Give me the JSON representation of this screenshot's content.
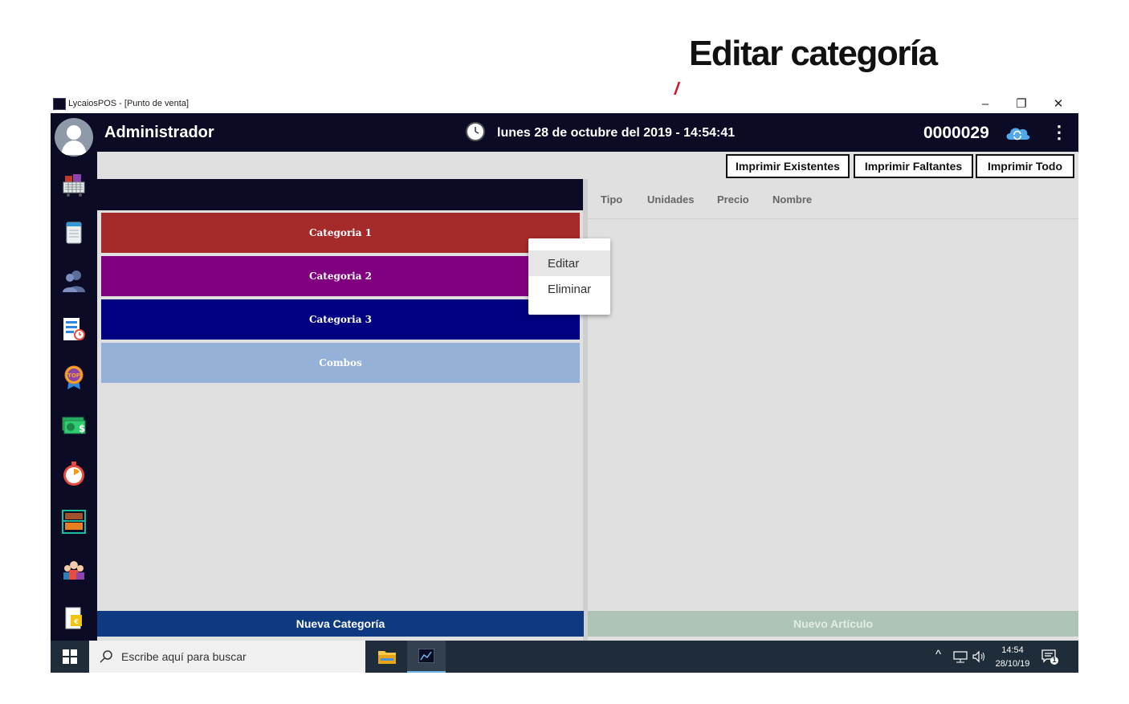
{
  "annotation": {
    "title": "Editar categoría"
  },
  "window": {
    "title": "LycaiosPOS - [Punto de venta]",
    "controls": {
      "minimize": "–",
      "restore": "❐",
      "close": "✕"
    }
  },
  "header": {
    "user": "Administrador",
    "datetime": "lunes 28 de octubre del 2019 - 14:54:41",
    "ticket_number": "0000029",
    "menu_icon": "⋮"
  },
  "sidebar": {
    "icons": [
      "cart-icon",
      "notebook-icon",
      "users-icon",
      "schedule-icon",
      "top-badge-icon",
      "money-icon",
      "timer-icon",
      "shelf-icon",
      "team-icon",
      "document-icon"
    ]
  },
  "toolbar": {
    "buttons": [
      "Imprimir Existentes",
      "Imprimir Faltantes",
      "Imprimir Todo"
    ]
  },
  "categories": [
    {
      "label": "Categoria 1",
      "color": "#a52a2a"
    },
    {
      "label": "Categoria 2",
      "color": "#800080"
    },
    {
      "label": "Categoria 3",
      "color": "#000080"
    },
    {
      "label": "Combos",
      "color": "#95b1d8"
    }
  ],
  "articles_table": {
    "columns": [
      "Tipo",
      "Unidades",
      "Precio",
      "Nombre"
    ]
  },
  "context_menu": {
    "items": [
      "Editar",
      "Eliminar"
    ]
  },
  "footer": {
    "new_category": "Nueva Categoría",
    "new_article": "Nuevo Artículo"
  },
  "taskbar": {
    "search_placeholder": "Escribe aquí para buscar",
    "tray_chevron": "^",
    "clock_time": "14:54",
    "clock_date": "28/10/19",
    "notification_count": "1"
  },
  "colors": {
    "app_dark": "#0b0b26",
    "content_bg": "#e0e0e0",
    "new_category_bg": "#0d3a80",
    "new_article_bg": "#adc4b6",
    "annotation_arrow": "#d0102a"
  }
}
